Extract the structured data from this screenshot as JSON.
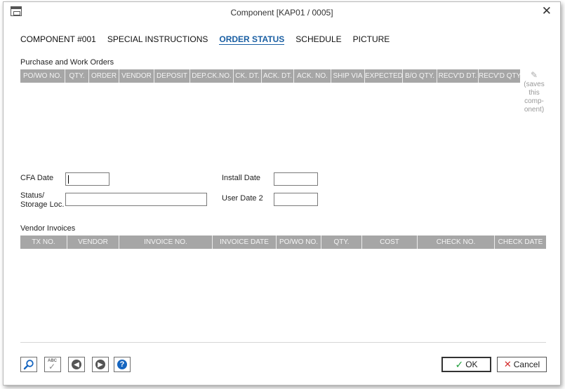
{
  "window": {
    "title": "Component [KAP01 / 0005]",
    "close_glyph": "✕"
  },
  "tabs": [
    {
      "label": "COMPONENT #001"
    },
    {
      "label": "SPECIAL INSTRUCTIONS"
    },
    {
      "label": "ORDER STATUS"
    },
    {
      "label": "SCHEDULE"
    },
    {
      "label": "PICTURE"
    }
  ],
  "purchase_orders": {
    "label": "Purchase and Work Orders",
    "columns": [
      "PO/WO NO.",
      "QTY.",
      "ORDER",
      "VENDOR",
      "DEPOSIT",
      "DEP.CK.NO.",
      "CK. DT.",
      "ACK. DT.",
      "ACK. NO.",
      "SHIP VIA",
      "EXPECTED",
      "B/O QTY.",
      "RECV'D DT.",
      "RECV'D QTY"
    ],
    "side_note": "(saves this comp-onent)"
  },
  "fields": {
    "cfa_date_label": "CFA Date",
    "cfa_date_value": "",
    "status_label": "Status/\nStorage Loc.",
    "status_value": "",
    "install_date_label": "Install Date",
    "install_date_value": "",
    "user_date2_label": "User Date 2",
    "user_date2_value": ""
  },
  "vendor_invoices": {
    "label": "Vendor Invoices",
    "columns": [
      "TX NO.",
      "VENDOR",
      "INVOICE NO.",
      "INVOICE DATE",
      "PO/WO NO.",
      "QTY.",
      "COST",
      "CHECK NO.",
      "CHECK DATE"
    ]
  },
  "toolbar": {
    "ok_label": "OK",
    "cancel_label": "Cancel",
    "spell_label": "ABC"
  },
  "colors": {
    "accent": "#1a5fa3",
    "grid_header": "#a6a6a6",
    "help_blue": "#1565c0"
  }
}
